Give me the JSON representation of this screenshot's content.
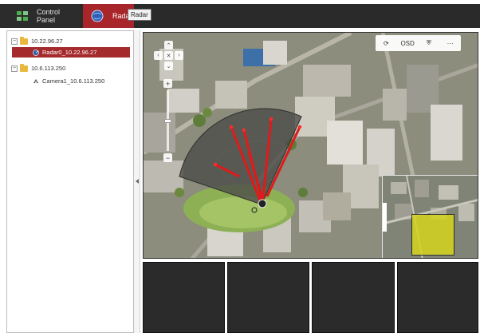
{
  "topbar": {
    "tabs": [
      {
        "label": "Control Panel",
        "icon": "grid-icon"
      },
      {
        "label": "Radar",
        "icon": "radar-globe-icon",
        "active": true
      }
    ],
    "tooltip": "Radar",
    "colors": {
      "bar": "#2a2a2a",
      "active_tab": "#a8262a"
    }
  },
  "sidebar": {
    "tree": [
      {
        "label": "10.22.96.27",
        "type": "server",
        "expanded": true
      },
      {
        "label": "Radar0_10.22.96.27",
        "type": "radar",
        "selected": true
      },
      {
        "label": "10.6.113.250",
        "type": "server",
        "expanded": true
      },
      {
        "label": "Camera1_10.6.113.250",
        "type": "camera"
      }
    ],
    "expander_symbol": "−"
  },
  "video": {
    "toolbar": {
      "refresh": "⟳",
      "osd_label": "OSD",
      "shield": "⛨",
      "more": "···"
    },
    "ptz": {
      "up": "⌃",
      "down": "⌄",
      "left": "‹",
      "right": "›",
      "center": "✕"
    },
    "zoom": {
      "in": "+",
      "out": "−",
      "level": 0.5
    },
    "minimap_accent": "#d6d41e"
  },
  "tiles_count": 4
}
